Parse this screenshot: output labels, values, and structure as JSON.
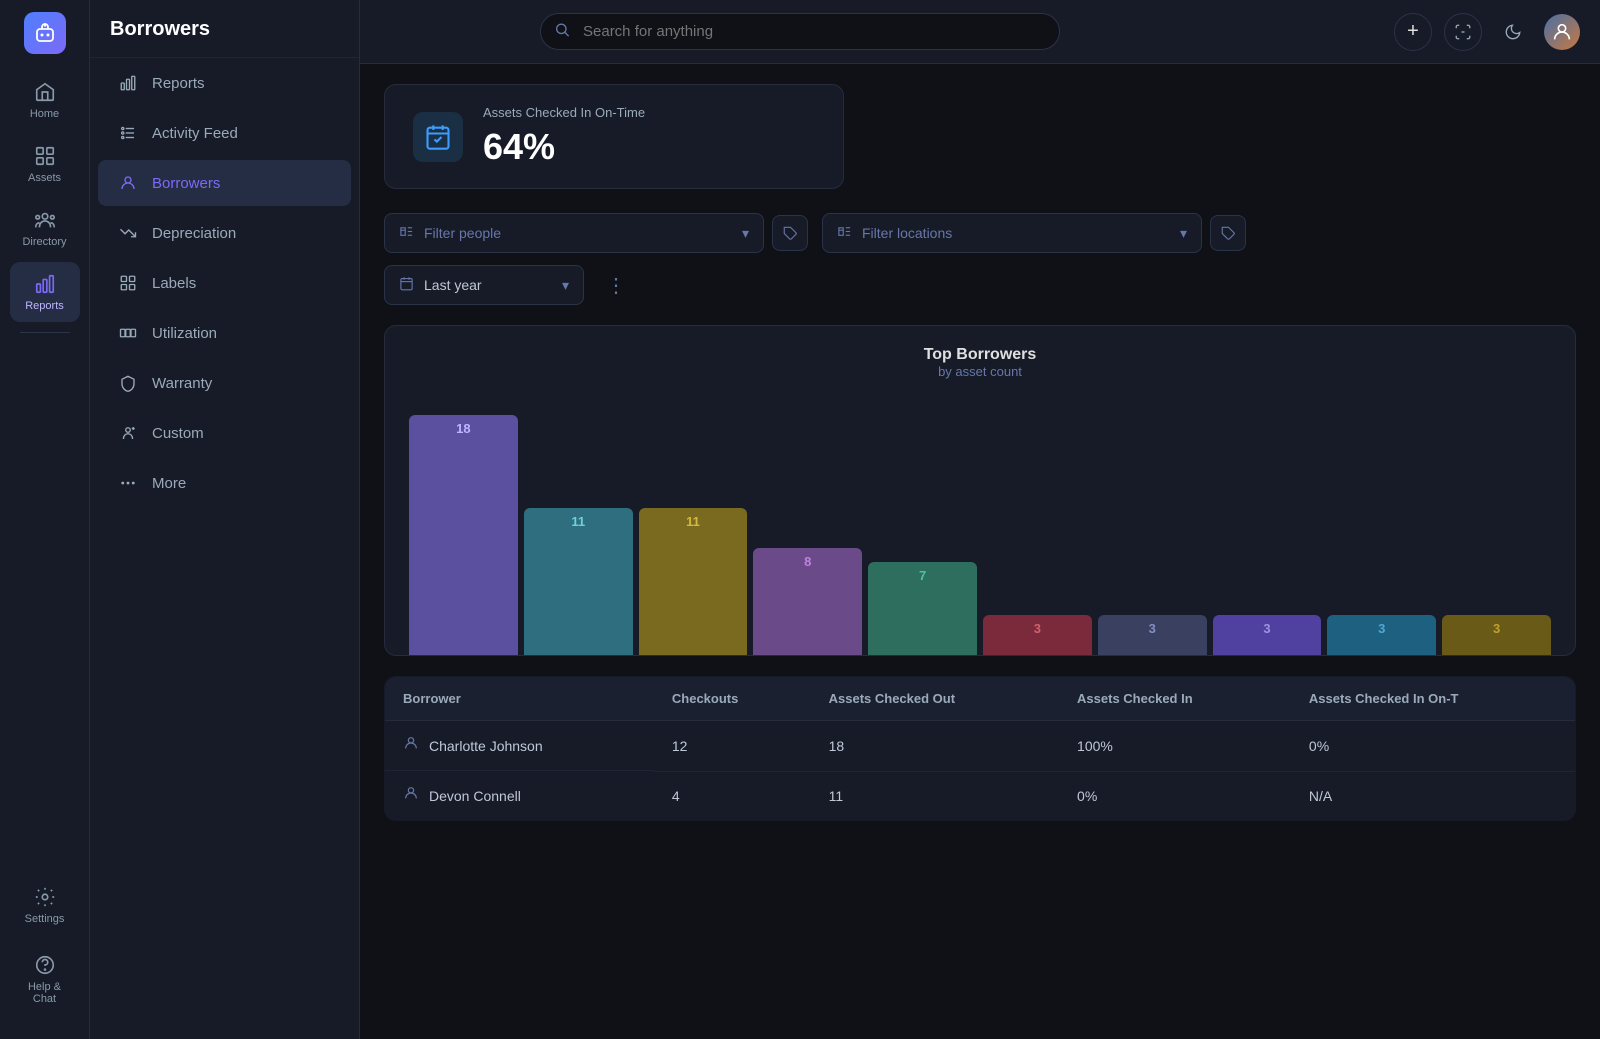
{
  "app": {
    "bot_icon": "🤖",
    "title": "Borrowers"
  },
  "topbar": {
    "search_placeholder": "Search for anything",
    "add_label": "+",
    "scan_label": "⊞"
  },
  "icon_sidebar": {
    "items": [
      {
        "id": "home",
        "label": "Home",
        "icon": "home"
      },
      {
        "id": "assets",
        "label": "Assets",
        "icon": "assets"
      },
      {
        "id": "directory",
        "label": "Directory",
        "icon": "directory",
        "active": false
      },
      {
        "id": "reports",
        "label": "Reports",
        "icon": "reports",
        "active": true
      }
    ],
    "bottom_items": [
      {
        "id": "settings",
        "label": "Settings",
        "icon": "settings"
      },
      {
        "id": "help",
        "label": "Help & Chat",
        "icon": "help"
      }
    ]
  },
  "nav_sidebar": {
    "title": "Borrowers",
    "items": [
      {
        "id": "reports",
        "label": "Reports",
        "icon": "bar-chart",
        "active": false
      },
      {
        "id": "activity",
        "label": "Activity Feed",
        "icon": "activity",
        "active": false
      },
      {
        "id": "borrowers",
        "label": "Borrowers",
        "icon": "person",
        "active": true
      },
      {
        "id": "depreciation",
        "label": "Depreciation",
        "icon": "trend-down",
        "active": false
      },
      {
        "id": "labels",
        "label": "Labels",
        "icon": "grid",
        "active": false
      },
      {
        "id": "utilization",
        "label": "Utilization",
        "icon": "layers",
        "active": false
      },
      {
        "id": "warranty",
        "label": "Warranty",
        "icon": "shield",
        "active": false
      },
      {
        "id": "custom",
        "label": "Custom",
        "icon": "custom-person",
        "active": false
      },
      {
        "id": "more",
        "label": "More",
        "icon": "plus",
        "active": false
      }
    ]
  },
  "stat_card": {
    "title": "Assets Checked In On-Time",
    "value": "64%",
    "icon": "calendar-check"
  },
  "filters": {
    "people_placeholder": "Filter people",
    "locations_placeholder": "Filter locations",
    "date_label": "Last year",
    "date_icon": "calendar"
  },
  "chart": {
    "title": "Top Borrowers",
    "subtitle": "by asset count",
    "bars": [
      {
        "value": 18,
        "color": "#5b4fa0",
        "label_color": "#c0b4ff"
      },
      {
        "value": 11,
        "color": "#2e6e7e",
        "label_color": "#6ecfe0"
      },
      {
        "value": 11,
        "color": "#7a6a20",
        "label_color": "#d4b840"
      },
      {
        "value": 8,
        "color": "#6b4a8a",
        "label_color": "#c080e0"
      },
      {
        "value": 7,
        "color": "#2d6e5e",
        "label_color": "#50c0a0"
      },
      {
        "value": 3,
        "color": "#7a2a3a",
        "label_color": "#d06070"
      },
      {
        "value": 3,
        "color": "#3a4060",
        "label_color": "#8090c0"
      },
      {
        "value": 3,
        "color": "#5040a0",
        "label_color": "#a090e0"
      },
      {
        "value": 3,
        "color": "#1e6080",
        "label_color": "#50a8d0"
      },
      {
        "value": 3,
        "color": "#6a5a18",
        "label_color": "#c0a030"
      }
    ]
  },
  "table": {
    "columns": [
      "Borrower",
      "Checkouts",
      "Assets Checked Out",
      "Assets Checked In",
      "Assets Checked In On-T"
    ],
    "rows": [
      {
        "borrower": "Charlotte Johnson",
        "checkouts": "12",
        "checked_out": "18",
        "checked_in": "100%",
        "on_time": "0%"
      },
      {
        "borrower": "Devon Connell",
        "checkouts": "4",
        "checked_out": "11",
        "checked_in": "0%",
        "on_time": "N/A"
      }
    ]
  }
}
